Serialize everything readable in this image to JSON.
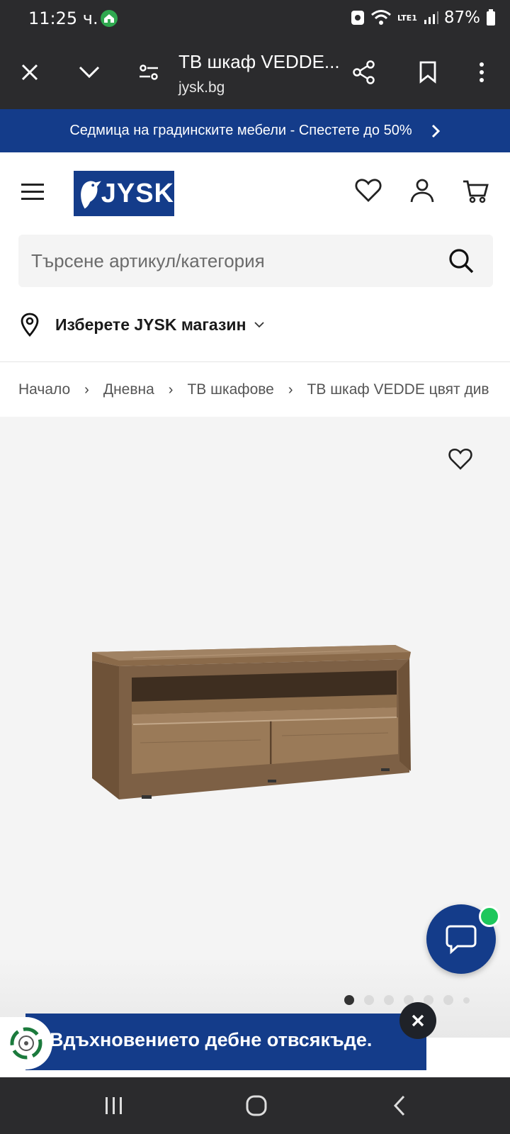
{
  "status_bar": {
    "time": "11:25 ч.",
    "battery": "87%",
    "network": "LTE1"
  },
  "browser": {
    "title": "ТВ шкаф VEDDE...",
    "url": "jysk.bg"
  },
  "promo": {
    "text": "Седмица на градинските мебели - Спестете до 50%"
  },
  "header": {
    "logo_text": "JYSK"
  },
  "search": {
    "placeholder": "Търсене артикул/категория"
  },
  "store": {
    "label": "Изберете JYSK магазин"
  },
  "breadcrumb": {
    "items": [
      "Начало",
      "Дневна",
      "ТВ шкафове",
      "ТВ шкаф VEDDE цвят див дъб"
    ]
  },
  "gallery": {
    "image_count": 7,
    "active_index": 0
  },
  "banner": {
    "text": "Вдъхновението дебне отвсякъде."
  },
  "colors": {
    "brand_blue": "#143c8a",
    "dark_bar": "#2b2b2d",
    "online_green": "#1ec75c"
  }
}
